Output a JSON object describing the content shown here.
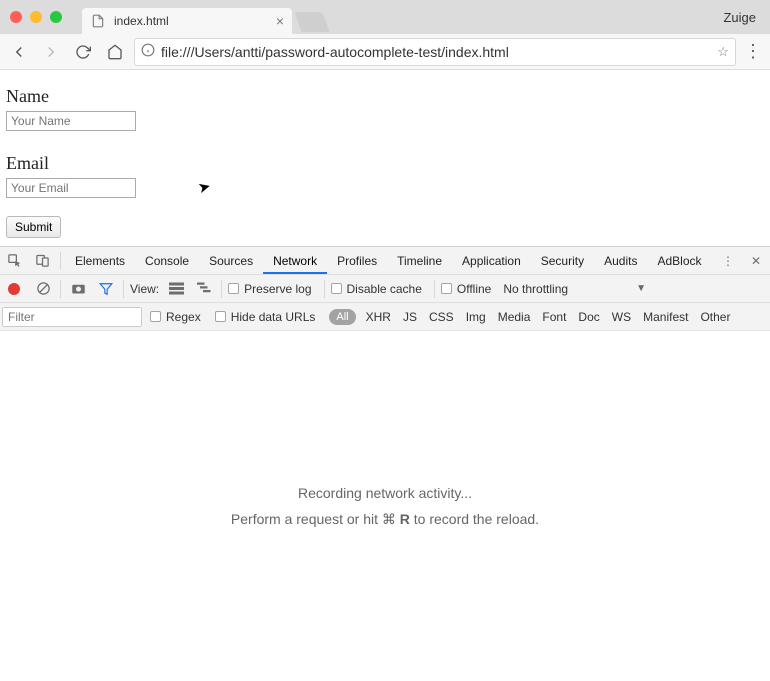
{
  "browser": {
    "profile": "Zuige",
    "tab_title": "index.html",
    "url": "file:///Users/antti/password-autocomplete-test/index.html"
  },
  "page": {
    "name_label": "Name",
    "name_placeholder": "Your Name",
    "email_label": "Email",
    "email_placeholder": "Your Email",
    "submit_label": "Submit"
  },
  "devtools": {
    "tabs": {
      "elements": "Elements",
      "console": "Console",
      "sources": "Sources",
      "network": "Network",
      "profiles": "Profiles",
      "timeline": "Timeline",
      "application": "Application",
      "security": "Security",
      "audits": "Audits",
      "adblock": "AdBlock"
    },
    "toolbar": {
      "view_label": "View:",
      "preserve_log": "Preserve log",
      "disable_cache": "Disable cache",
      "offline": "Offline",
      "throttling": "No throttling"
    },
    "filters": {
      "placeholder": "Filter",
      "regex": "Regex",
      "hide_data_urls": "Hide data URLs",
      "all": "All",
      "types": {
        "xhr": "XHR",
        "js": "JS",
        "css": "CSS",
        "img": "Img",
        "media": "Media",
        "font": "Font",
        "doc": "Doc",
        "ws": "WS",
        "manifest": "Manifest",
        "other": "Other"
      }
    },
    "empty": {
      "line1": "Recording network activity...",
      "line2_pre": "Perform a request or hit ",
      "cmd": "⌘",
      "key": "R",
      "line2_post": " to record the reload."
    }
  }
}
